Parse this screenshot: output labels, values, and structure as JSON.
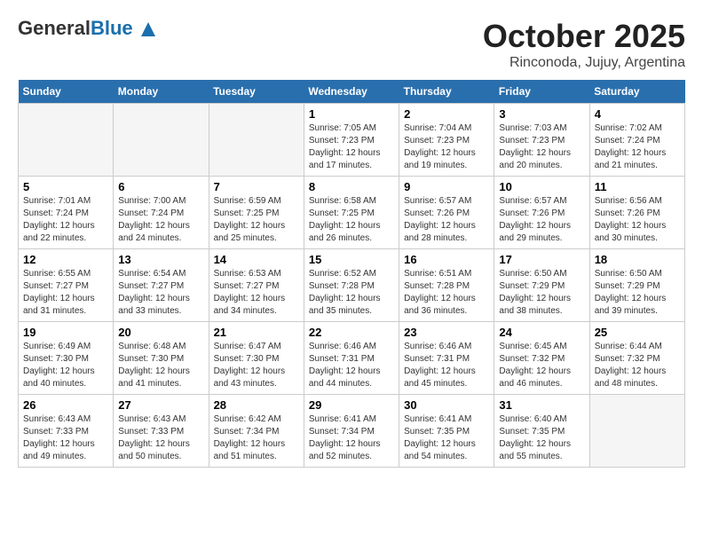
{
  "header": {
    "logo_general": "General",
    "logo_blue": "Blue",
    "month": "October 2025",
    "location": "Rinconoda, Jujuy, Argentina"
  },
  "days_of_week": [
    "Sunday",
    "Monday",
    "Tuesday",
    "Wednesday",
    "Thursday",
    "Friday",
    "Saturday"
  ],
  "weeks": [
    [
      {
        "day": "",
        "empty": true
      },
      {
        "day": "",
        "empty": true
      },
      {
        "day": "",
        "empty": true
      },
      {
        "day": "1",
        "sunrise": "7:05 AM",
        "sunset": "7:23 PM",
        "daylight": "12 hours and 17 minutes."
      },
      {
        "day": "2",
        "sunrise": "7:04 AM",
        "sunset": "7:23 PM",
        "daylight": "12 hours and 19 minutes."
      },
      {
        "day": "3",
        "sunrise": "7:03 AM",
        "sunset": "7:23 PM",
        "daylight": "12 hours and 20 minutes."
      },
      {
        "day": "4",
        "sunrise": "7:02 AM",
        "sunset": "7:24 PM",
        "daylight": "12 hours and 21 minutes."
      }
    ],
    [
      {
        "day": "5",
        "sunrise": "7:01 AM",
        "sunset": "7:24 PM",
        "daylight": "12 hours and 22 minutes."
      },
      {
        "day": "6",
        "sunrise": "7:00 AM",
        "sunset": "7:24 PM",
        "daylight": "12 hours and 24 minutes."
      },
      {
        "day": "7",
        "sunrise": "6:59 AM",
        "sunset": "7:25 PM",
        "daylight": "12 hours and 25 minutes."
      },
      {
        "day": "8",
        "sunrise": "6:58 AM",
        "sunset": "7:25 PM",
        "daylight": "12 hours and 26 minutes."
      },
      {
        "day": "9",
        "sunrise": "6:57 AM",
        "sunset": "7:26 PM",
        "daylight": "12 hours and 28 minutes."
      },
      {
        "day": "10",
        "sunrise": "6:57 AM",
        "sunset": "7:26 PM",
        "daylight": "12 hours and 29 minutes."
      },
      {
        "day": "11",
        "sunrise": "6:56 AM",
        "sunset": "7:26 PM",
        "daylight": "12 hours and 30 minutes."
      }
    ],
    [
      {
        "day": "12",
        "sunrise": "6:55 AM",
        "sunset": "7:27 PM",
        "daylight": "12 hours and 31 minutes."
      },
      {
        "day": "13",
        "sunrise": "6:54 AM",
        "sunset": "7:27 PM",
        "daylight": "12 hours and 33 minutes."
      },
      {
        "day": "14",
        "sunrise": "6:53 AM",
        "sunset": "7:27 PM",
        "daylight": "12 hours and 34 minutes."
      },
      {
        "day": "15",
        "sunrise": "6:52 AM",
        "sunset": "7:28 PM",
        "daylight": "12 hours and 35 minutes."
      },
      {
        "day": "16",
        "sunrise": "6:51 AM",
        "sunset": "7:28 PM",
        "daylight": "12 hours and 36 minutes."
      },
      {
        "day": "17",
        "sunrise": "6:50 AM",
        "sunset": "7:29 PM",
        "daylight": "12 hours and 38 minutes."
      },
      {
        "day": "18",
        "sunrise": "6:50 AM",
        "sunset": "7:29 PM",
        "daylight": "12 hours and 39 minutes."
      }
    ],
    [
      {
        "day": "19",
        "sunrise": "6:49 AM",
        "sunset": "7:30 PM",
        "daylight": "12 hours and 40 minutes."
      },
      {
        "day": "20",
        "sunrise": "6:48 AM",
        "sunset": "7:30 PM",
        "daylight": "12 hours and 41 minutes."
      },
      {
        "day": "21",
        "sunrise": "6:47 AM",
        "sunset": "7:30 PM",
        "daylight": "12 hours and 43 minutes."
      },
      {
        "day": "22",
        "sunrise": "6:46 AM",
        "sunset": "7:31 PM",
        "daylight": "12 hours and 44 minutes."
      },
      {
        "day": "23",
        "sunrise": "6:46 AM",
        "sunset": "7:31 PM",
        "daylight": "12 hours and 45 minutes."
      },
      {
        "day": "24",
        "sunrise": "6:45 AM",
        "sunset": "7:32 PM",
        "daylight": "12 hours and 46 minutes."
      },
      {
        "day": "25",
        "sunrise": "6:44 AM",
        "sunset": "7:32 PM",
        "daylight": "12 hours and 48 minutes."
      }
    ],
    [
      {
        "day": "26",
        "sunrise": "6:43 AM",
        "sunset": "7:33 PM",
        "daylight": "12 hours and 49 minutes."
      },
      {
        "day": "27",
        "sunrise": "6:43 AM",
        "sunset": "7:33 PM",
        "daylight": "12 hours and 50 minutes."
      },
      {
        "day": "28",
        "sunrise": "6:42 AM",
        "sunset": "7:34 PM",
        "daylight": "12 hours and 51 minutes."
      },
      {
        "day": "29",
        "sunrise": "6:41 AM",
        "sunset": "7:34 PM",
        "daylight": "12 hours and 52 minutes."
      },
      {
        "day": "30",
        "sunrise": "6:41 AM",
        "sunset": "7:35 PM",
        "daylight": "12 hours and 54 minutes."
      },
      {
        "day": "31",
        "sunrise": "6:40 AM",
        "sunset": "7:35 PM",
        "daylight": "12 hours and 55 minutes."
      },
      {
        "day": "",
        "empty": true
      }
    ]
  ]
}
